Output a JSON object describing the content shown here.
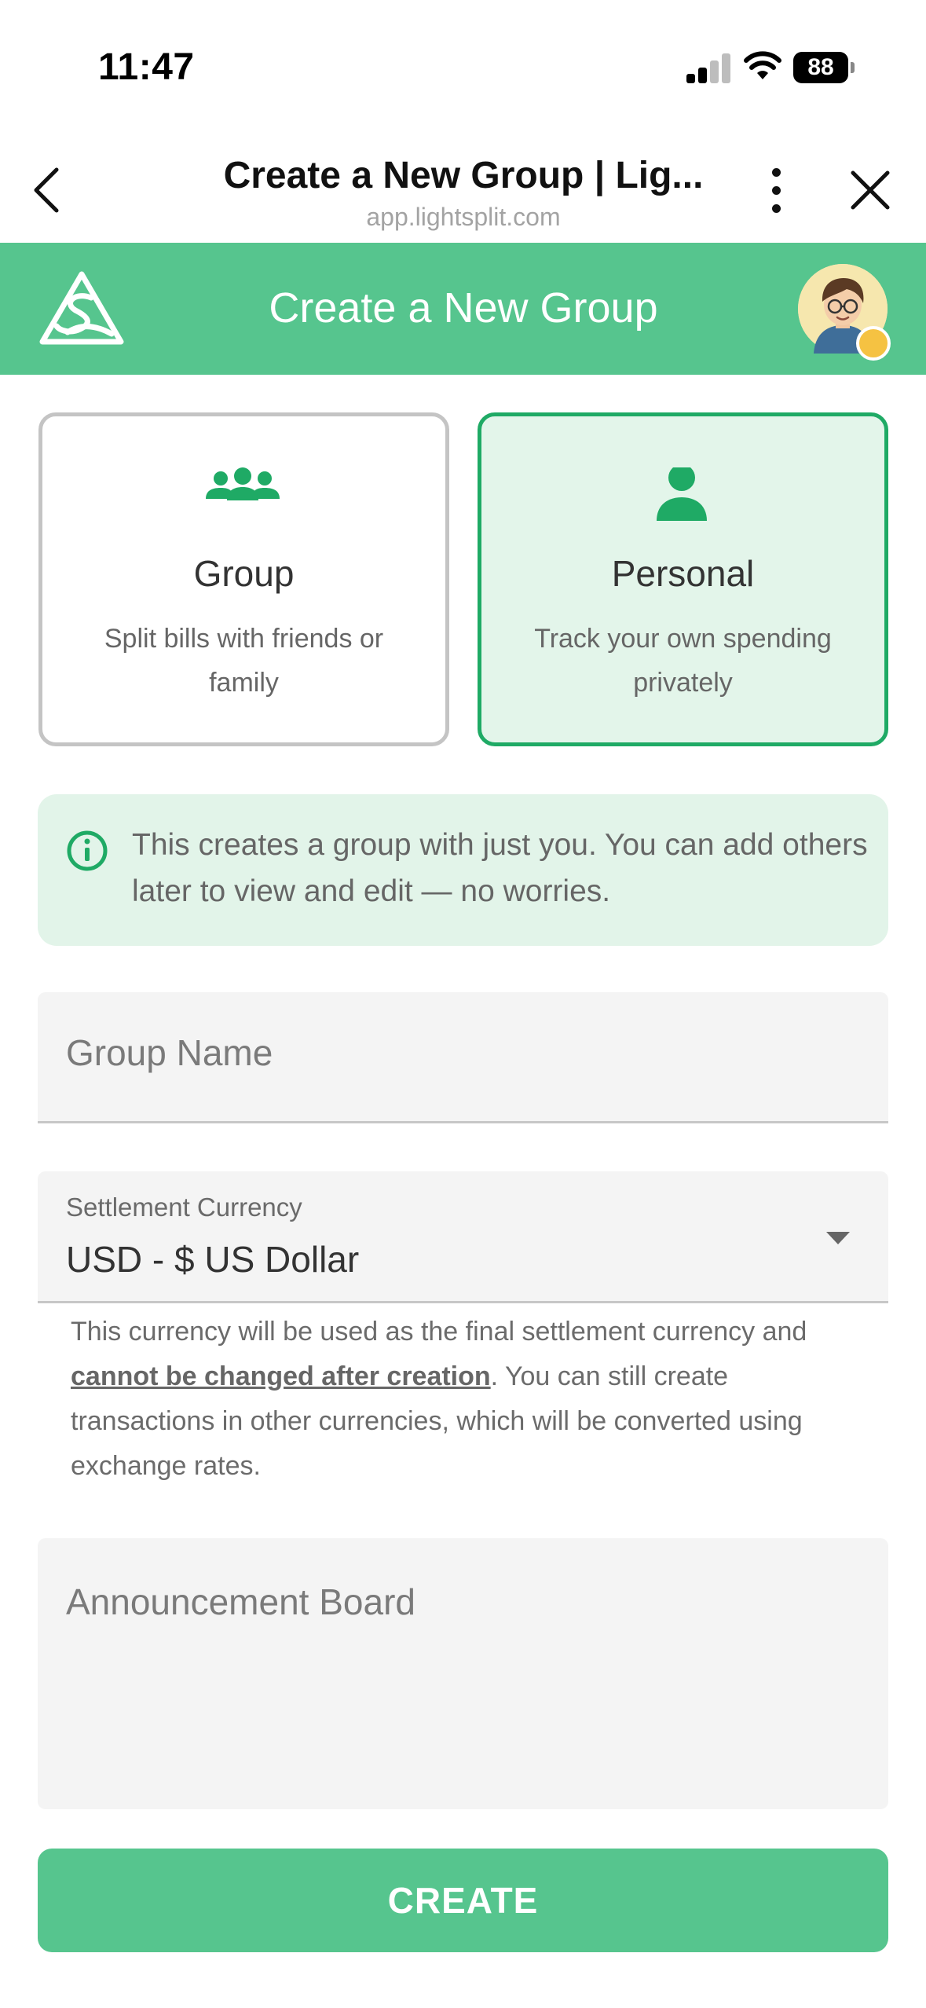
{
  "status_bar": {
    "time": "11:47",
    "battery": "88"
  },
  "browser": {
    "title": "Create a New Group | Lig...",
    "url": "app.lightsplit.com"
  },
  "app_bar": {
    "title": "Create a New Group"
  },
  "type_options": [
    {
      "title": "Group",
      "description": "Split bills with friends or family",
      "selected": false,
      "icon": "group-icon"
    },
    {
      "title": "Personal",
      "description": "Track your own spending privately",
      "selected": true,
      "icon": "person-icon"
    }
  ],
  "info": {
    "text": "This creates a group with just you. You can add others later to view and edit — no worries."
  },
  "form": {
    "group_name_placeholder": "Group Name",
    "currency_label": "Settlement Currency",
    "currency_value": "USD - $ US Dollar",
    "currency_help_before": "This currency will be used as the final settlement currency and ",
    "currency_help_emphasis": "cannot be changed after creation",
    "currency_help_after": ". You can still create transactions in other currencies, which will be converted using exchange rates.",
    "announcement_placeholder": "Announcement Board"
  },
  "create_label": "CREATE",
  "colors": {
    "brand_green": "#56c58e",
    "selected_border": "#1faa65",
    "selected_bg": "#e3f5ea",
    "info_bg": "#e2f4e9"
  }
}
